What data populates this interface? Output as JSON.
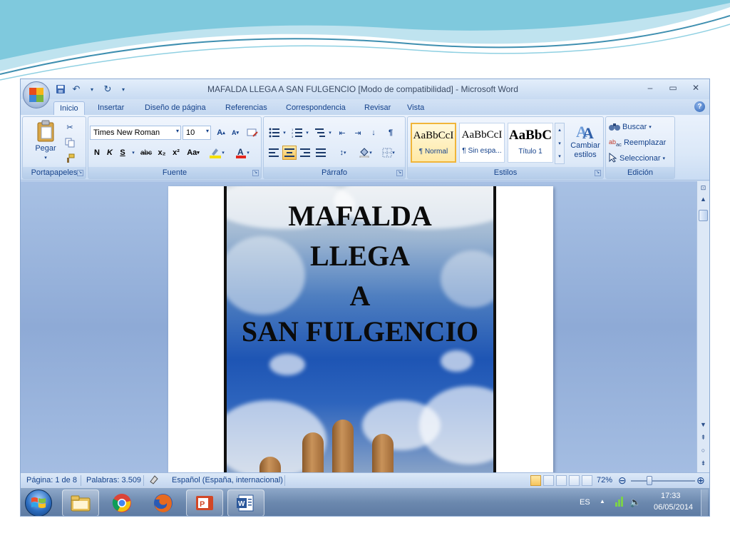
{
  "window": {
    "title": "MAFALDA LLEGA A SAN FULGENCIO [Modo de compatibilidad] - Microsoft Word",
    "controls": {
      "minimize": "–",
      "restore": "▭",
      "close": "✕"
    }
  },
  "tabs": [
    "Inicio",
    "Insertar",
    "Diseño de página",
    "Referencias",
    "Correspondencia",
    "Revisar",
    "Vista"
  ],
  "active_tab": "Inicio",
  "ribbon": {
    "clipboard": {
      "label": "Portapapeles",
      "paste": "Pegar"
    },
    "font": {
      "label": "Fuente",
      "family": "Times New Roman",
      "size": "10",
      "bold": "N",
      "italic": "K",
      "underline": "S",
      "strike": "abc",
      "subscript": "x₂",
      "superscript": "x²",
      "change_case": "Aa",
      "grow": "A",
      "shrink": "A"
    },
    "paragraph": {
      "label": "Párrafo"
    },
    "styles": {
      "label": "Estilos",
      "items": [
        {
          "sample": "AaBbCcI",
          "name": "¶ Normal"
        },
        {
          "sample": "AaBbCcI",
          "name": "¶ Sin espa..."
        },
        {
          "sample": "AaBbC",
          "name": "Título 1"
        }
      ],
      "change_styles": "Cambiar estilos"
    },
    "editing": {
      "label": "Edición",
      "find": "Buscar",
      "replace": "Reemplazar",
      "select": "Seleccionar"
    }
  },
  "document": {
    "cover_lines": [
      "MAFALDA",
      "LLEGA",
      "A",
      "SAN FULGENCIO"
    ]
  },
  "status": {
    "page": "Página: 1 de 8",
    "words": "Palabras: 3.509",
    "language": "Español (España, internacional)",
    "zoom": "72%"
  },
  "taskbar": {
    "lang": "ES",
    "time": "17:33",
    "date": "06/05/2014"
  },
  "colors": {
    "ribbon_text": "#15428b",
    "selected_style": "#f0b53a"
  }
}
